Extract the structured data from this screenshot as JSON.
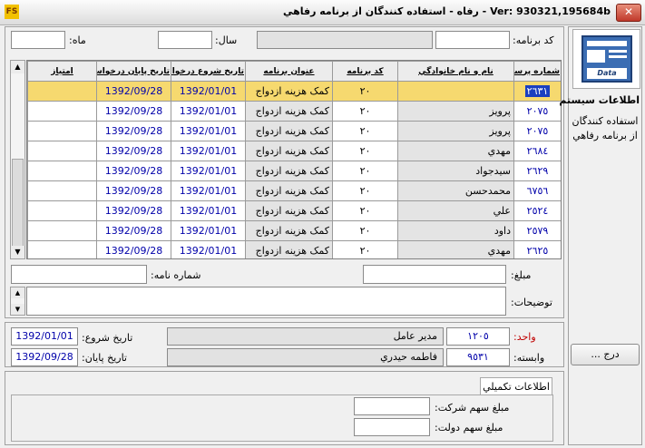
{
  "window": {
    "title": "Ver: 930321,195684b - رفاه - استفاده کنندگان از برنامه رفاهي",
    "close": "✕",
    "app_icon": "FS"
  },
  "filters": {
    "program_code_label": "کد برنامه:",
    "year_label": "سال:",
    "month_label": "ماه:"
  },
  "grid": {
    "headers": {
      "id": "شماره پرسنلي",
      "name": "نام و نام خانوادگي",
      "code": "کد برنامه",
      "title": "عنوان برنامه",
      "start": "تاريخ شروع درخواست",
      "end": "تاريخ پايان درخواست",
      "score": "امتياز"
    },
    "rows": [
      {
        "id": "٢٦٣١",
        "name": "",
        "code": "٢٠",
        "title": "كمک هزينه ازدواج",
        "start": "1392/01/01",
        "end": "1392/09/28",
        "score": ""
      },
      {
        "id": "٢٠٧٥",
        "name": "پرويز",
        "code": "٢٠",
        "title": "كمک هزينه ازدواج",
        "start": "1392/01/01",
        "end": "1392/09/28",
        "score": ""
      },
      {
        "id": "٢٠٧٥",
        "name": "پرويز",
        "code": "٢٠",
        "title": "كمک هزينه ازدواج",
        "start": "1392/01/01",
        "end": "1392/09/28",
        "score": ""
      },
      {
        "id": "٢٦٨٤",
        "name": "مهدي",
        "code": "٢٠",
        "title": "كمک هزينه ازدواج",
        "start": "1392/01/01",
        "end": "1392/09/28",
        "score": ""
      },
      {
        "id": "٢٦٢٩",
        "name": "سيدجواد",
        "code": "٢٠",
        "title": "كمک هزينه ازدواج",
        "start": "1392/01/01",
        "end": "1392/09/28",
        "score": ""
      },
      {
        "id": "٦٧٥٦",
        "name": "محمدحسن",
        "code": "٢٠",
        "title": "كمک هزينه ازدواج",
        "start": "1392/01/01",
        "end": "1392/09/28",
        "score": ""
      },
      {
        "id": "٢٥٢٤",
        "name": "علي",
        "code": "٢٠",
        "title": "كمک هزينه ازدواج",
        "start": "1392/01/01",
        "end": "1392/09/28",
        "score": ""
      },
      {
        "id": "٢٥٧٩",
        "name": "داود",
        "code": "٢٠",
        "title": "كمک هزينه ازدواج",
        "start": "1392/01/01",
        "end": "1392/09/28",
        "score": ""
      },
      {
        "id": "٢٦٢٥",
        "name": "مهدي",
        "code": "٢٠",
        "title": "كمک هزينه ازدواج",
        "start": "1392/01/01",
        "end": "1392/09/28",
        "score": ""
      }
    ]
  },
  "details": {
    "amount_label": "مبلغ:",
    "letter_no_label": "شماره نامه:",
    "description_label": "توضيحات:"
  },
  "org": {
    "unit_label": "واحد:",
    "unit_code": "١٢٠٥",
    "unit_name": "مدير عامل",
    "dependent_label": "وابسته:",
    "dependent_code": "٩٥٣١",
    "dependent_name": "فاطمه حيدري",
    "start_label": "تاريخ شروع:",
    "start_value": "1392/01/01",
    "end_label": "تاريخ پايان:",
    "end_value": "1392/09/28"
  },
  "extra": {
    "tab_label": "اطلاعات تكميلي",
    "company_share_label": "مبلغ سهم شركت:",
    "gov_share_label": "مبلغ سهم دولت:"
  },
  "sidebar": {
    "logo_text": "Data",
    "title": "اطلاعات سيستم",
    "description": "استفاده كنندگان از برنامه رفاهي",
    "insert_button": "درج ..."
  },
  "colors": {
    "selected_row": "#f6d96f",
    "unit_label": "#c00000",
    "link_blue": "#0000aa"
  }
}
